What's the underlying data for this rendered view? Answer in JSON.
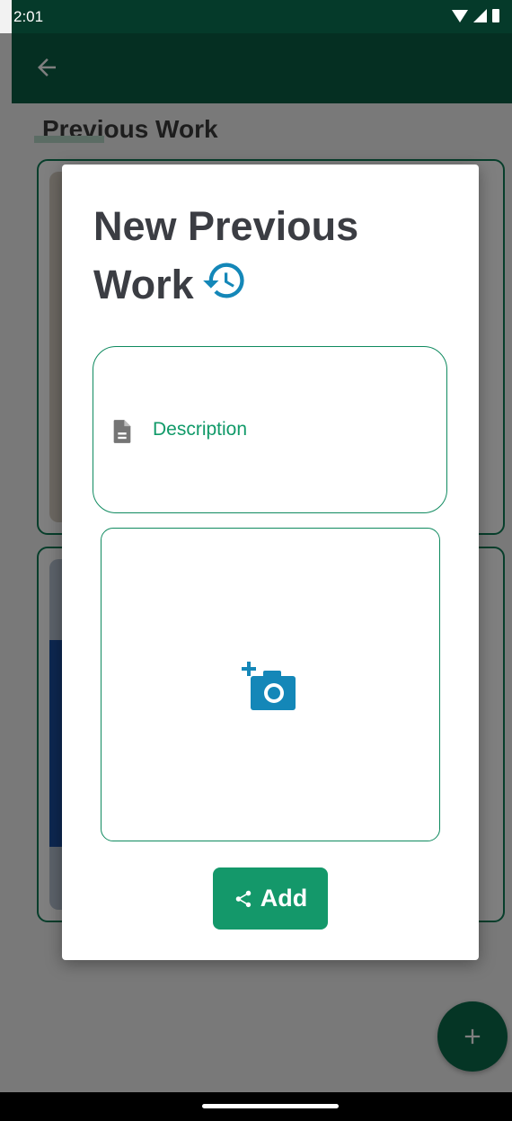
{
  "status_bar": {
    "time": "2:01"
  },
  "page": {
    "title": "Previous Work"
  },
  "dialog": {
    "title": "New Previous Work",
    "title_icon": "history-icon",
    "description": {
      "placeholder": "Description",
      "icon": "document-icon"
    },
    "photo_picker": {
      "icon": "add-photo-camera-icon"
    },
    "add_button": {
      "label": "Add",
      "icon": "share-icon"
    }
  },
  "fab": {
    "icon": "plus-icon"
  },
  "colors": {
    "status_bar": "#053a2a",
    "app_bar": "#0a5f45",
    "accent": "#14986a",
    "camera": "#1487b8",
    "title_text": "#3b3d43"
  }
}
